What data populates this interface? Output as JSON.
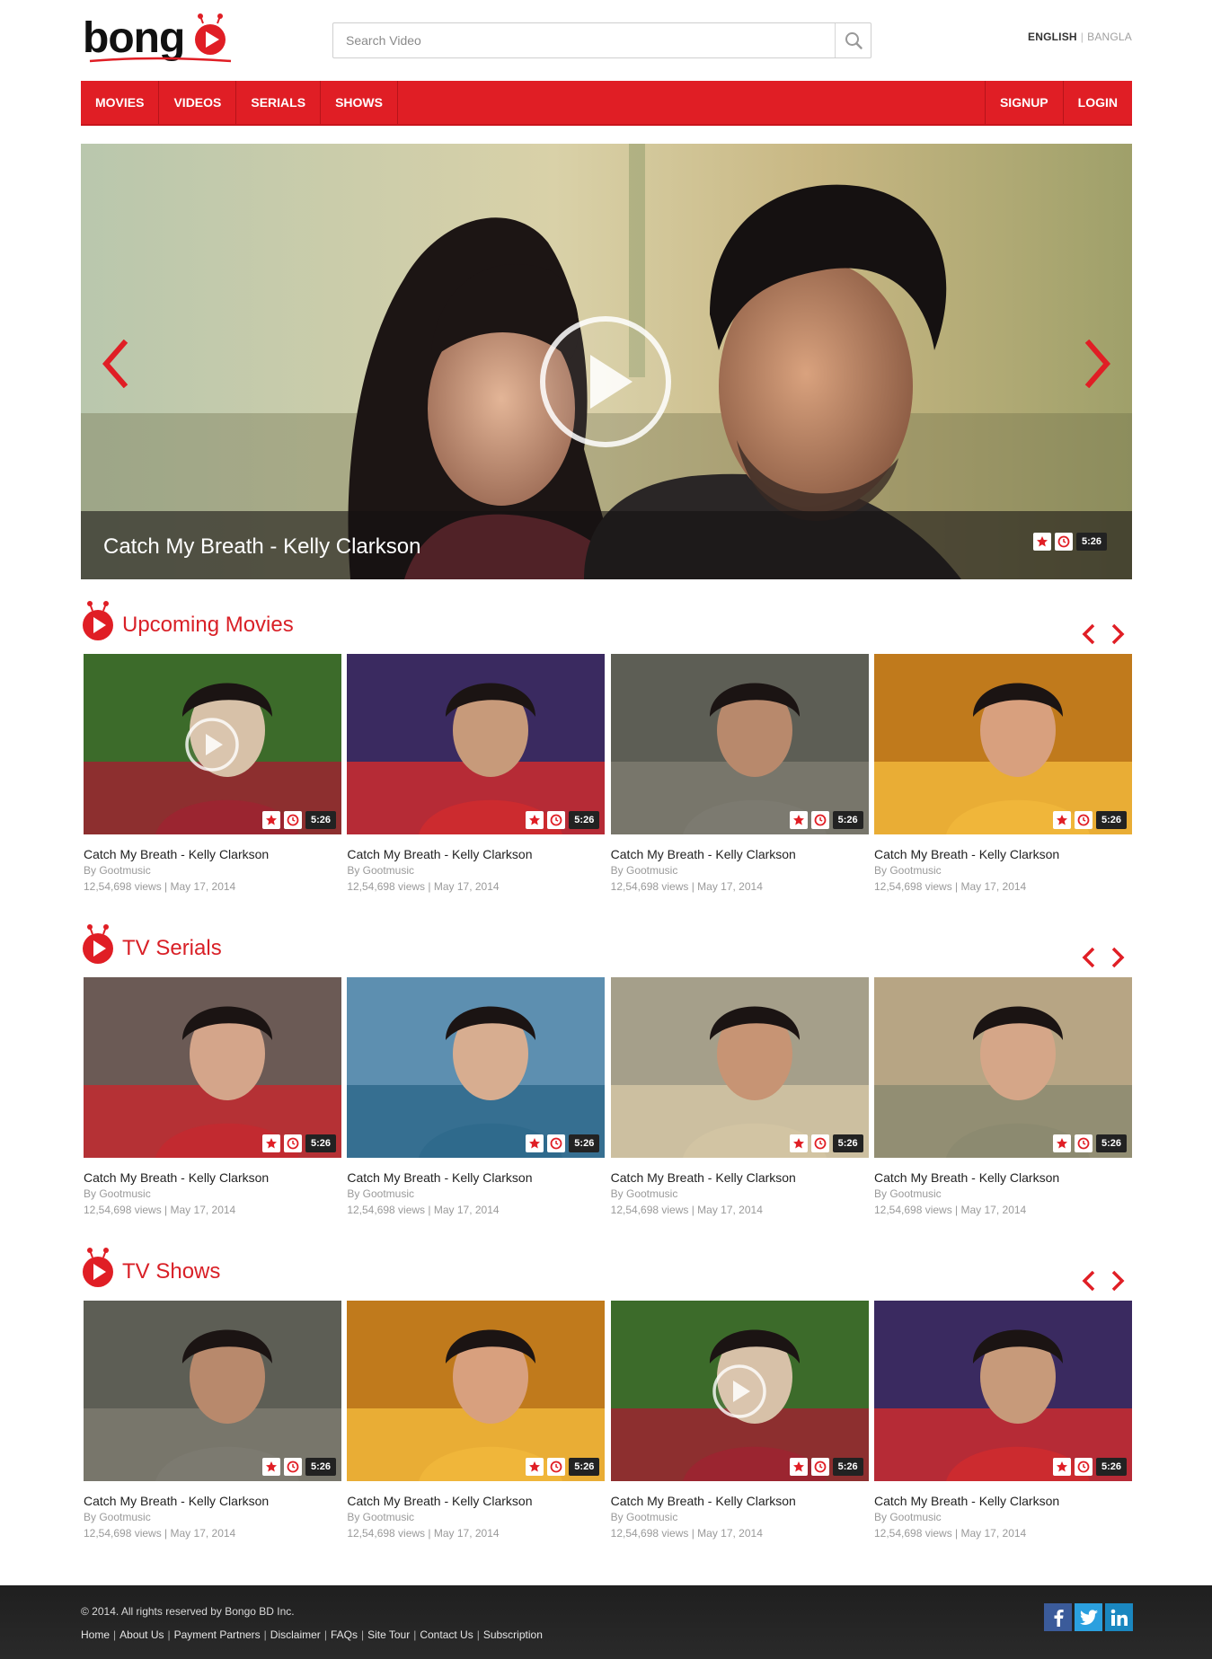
{
  "header": {
    "logo_text": "bongo",
    "search_placeholder": "Search Video",
    "lang_english": "ENGLISH",
    "lang_separator": "|",
    "lang_bangla": "BANGLA"
  },
  "nav": {
    "left": [
      "MOVIES",
      "VIDEOS",
      "SERIALS",
      "SHOWS"
    ],
    "right": [
      "SIGNUP",
      "LOGIN"
    ]
  },
  "hero": {
    "title": "Catch My Breath - Kelly Clarkson",
    "duration": "5:26"
  },
  "sections": [
    {
      "title": "Upcoming Movies",
      "cards": [
        {
          "title": "Catch My Breath - Kelly Clarkson",
          "by": "By Gootmusic",
          "meta": "12,54,698 views | May 17, 2014",
          "duration": "5:26"
        },
        {
          "title": "Catch My Breath - Kelly Clarkson",
          "by": "By Gootmusic",
          "meta": "12,54,698 views | May 17, 2014",
          "duration": "5:26"
        },
        {
          "title": "Catch My Breath - Kelly Clarkson",
          "by": "By Gootmusic",
          "meta": "12,54,698 views | May 17, 2014",
          "duration": "5:26"
        },
        {
          "title": "Catch My Breath - Kelly Clarkson",
          "by": "By Gootmusic",
          "meta": "12,54,698 views | May 17, 2014",
          "duration": "5:26"
        }
      ]
    },
    {
      "title": "TV Serials",
      "cards": [
        {
          "title": "Catch My Breath - Kelly Clarkson",
          "by": "By Gootmusic",
          "meta": "12,54,698 views | May 17, 2014",
          "duration": "5:26"
        },
        {
          "title": "Catch My Breath - Kelly Clarkson",
          "by": "By Gootmusic",
          "meta": "12,54,698 views | May 17, 2014",
          "duration": "5:26"
        },
        {
          "title": "Catch My Breath - Kelly Clarkson",
          "by": "By Gootmusic",
          "meta": "12,54,698 views | May 17, 2014",
          "duration": "5:26"
        },
        {
          "title": "Catch My Breath - Kelly Clarkson",
          "by": "By Gootmusic",
          "meta": "12,54,698 views | May 17, 2014",
          "duration": "5:26"
        }
      ]
    },
    {
      "title": "TV Shows",
      "cards": [
        {
          "title": "Catch My Breath - Kelly Clarkson",
          "by": "By Gootmusic",
          "meta": "12,54,698 views | May 17, 2014",
          "duration": "5:26"
        },
        {
          "title": "Catch My Breath - Kelly Clarkson",
          "by": "By Gootmusic",
          "meta": "12,54,698 views | May 17, 2014",
          "duration": "5:26"
        },
        {
          "title": "Catch My Breath - Kelly Clarkson",
          "by": "By Gootmusic",
          "meta": "12,54,698 views | May 17, 2014",
          "duration": "5:26"
        },
        {
          "title": "Catch My Breath - Kelly Clarkson",
          "by": "By Gootmusic",
          "meta": "12,54,698 views | May 17, 2014",
          "duration": "5:26"
        }
      ]
    }
  ],
  "footer": {
    "copyright": "© 2014. All rights reserved by Bongo BD Inc.",
    "links": [
      "Home",
      "About Us",
      "Payment Partners",
      "Disclaimer",
      "FAQs",
      "Site Tour",
      "Contact Us",
      "Subscription"
    ],
    "social": [
      "facebook-icon",
      "twitter-icon",
      "linkedin-icon"
    ]
  },
  "colors": {
    "brand_red": "#e01e25",
    "footer_bg": "#232323"
  }
}
